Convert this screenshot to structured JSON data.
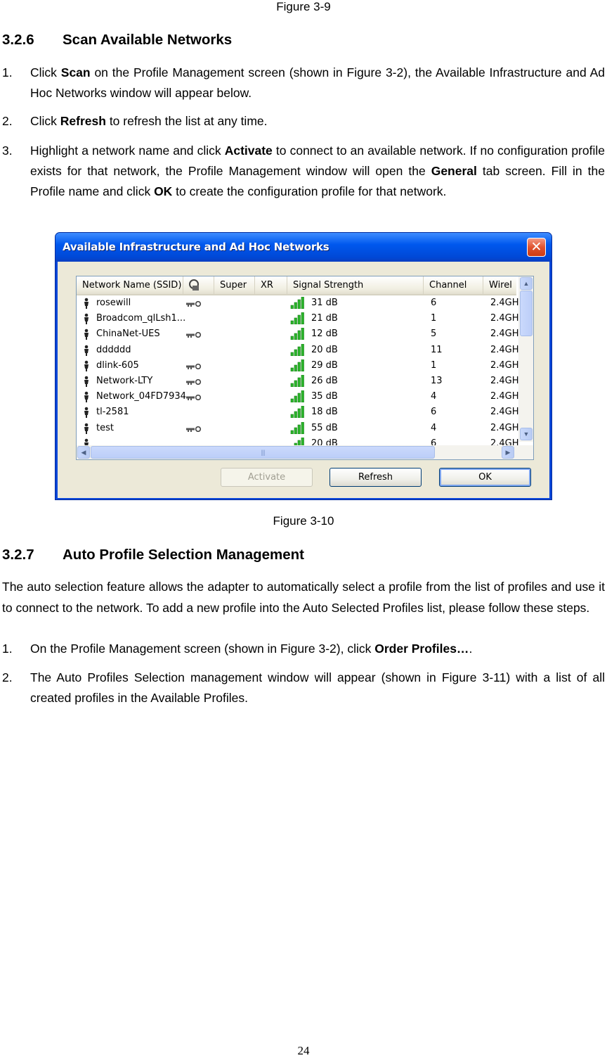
{
  "captions": {
    "fig_top": "Figure 3-9",
    "fig_dialog": "Figure 3-10"
  },
  "section_scan": {
    "number": "3.2.6",
    "title": "Scan Available Networks",
    "steps": [
      {
        "n": "1.",
        "pre": "Click ",
        "bold": "Scan",
        "post": " on the Profile Management screen (shown in Figure 3-2), the Available Infrastructure and Ad Hoc Networks window will appear below."
      },
      {
        "n": "2.",
        "pre": "Click ",
        "bold": "Refresh",
        "post": " to refresh the list at any time."
      },
      {
        "n": "3.",
        "pre": "Highlight a network name and click ",
        "bold": "Activate",
        "mid": " to connect to an available network. If no configuration profile exists for that network, the Profile Management window will open the ",
        "bold2": "General",
        "mid2": " tab screen. Fill in the Profile name and click ",
        "bold3": "OK",
        "post": " to create the configuration profile for that network."
      }
    ]
  },
  "dialog": {
    "title": "Available Infrastructure and Ad Hoc Networks",
    "close_glyph": "✕",
    "columns": [
      "Network Name (SSID)",
      "",
      "Super",
      "XR",
      "Signal Strength",
      "Channel",
      "Wirel"
    ],
    "rows": [
      {
        "ssid": "rosewill",
        "secure": true,
        "signal": "31 dB",
        "channel": "6",
        "wireless": "2.4GH"
      },
      {
        "ssid": "Broadcom_qlLsh1...",
        "secure": false,
        "signal": "21 dB",
        "channel": "1",
        "wireless": "2.4GH"
      },
      {
        "ssid": "ChinaNet-UES",
        "secure": true,
        "signal": "12 dB",
        "channel": "5",
        "wireless": "2.4GH"
      },
      {
        "ssid": "dddddd",
        "secure": false,
        "signal": "20 dB",
        "channel": "11",
        "wireless": "2.4GH"
      },
      {
        "ssid": "dlink-605",
        "secure": true,
        "signal": "29 dB",
        "channel": "1",
        "wireless": "2.4GH"
      },
      {
        "ssid": "Network-LTY",
        "secure": true,
        "signal": "26 dB",
        "channel": "13",
        "wireless": "2.4GH"
      },
      {
        "ssid": "Network_04FD7934",
        "secure": true,
        "signal": "35 dB",
        "channel": "4",
        "wireless": "2.4GH"
      },
      {
        "ssid": "tl-2581",
        "secure": false,
        "signal": "18 dB",
        "channel": "6",
        "wireless": "2.4GH"
      },
      {
        "ssid": "test",
        "secure": true,
        "signal": "55 dB",
        "channel": "4",
        "wireless": "2.4GH"
      },
      {
        "ssid": "",
        "secure": false,
        "signal": "20 dB",
        "channel": "6",
        "wireless": "2.4GH"
      }
    ],
    "buttons": {
      "activate": "Activate",
      "refresh": "Refresh",
      "ok": "OK"
    },
    "colors": {
      "titlebar": "#0058ee",
      "signal_bars": "#2bb52b",
      "client": "#ece9d8"
    }
  },
  "section_auto": {
    "number": "3.2.7",
    "title": "Auto Profile Selection Management",
    "intro": "The auto selection feature allows the adapter to automatically select a profile from the list of profiles and use it to connect to the network. To add a new profile into the Auto Selected Profiles list, please follow these steps.",
    "steps": [
      {
        "n": "1.",
        "pre": "On the Profile Management screen (shown in Figure 3-2), click ",
        "bold": "Order Profiles…",
        "post": "."
      },
      {
        "n": "2.",
        "pre": "The Auto Profiles Selection management window will appear (shown in Figure 3-11) with a list of all created profiles in the Available Profiles.",
        "bold": "",
        "post": ""
      }
    ]
  },
  "page_number": "24"
}
